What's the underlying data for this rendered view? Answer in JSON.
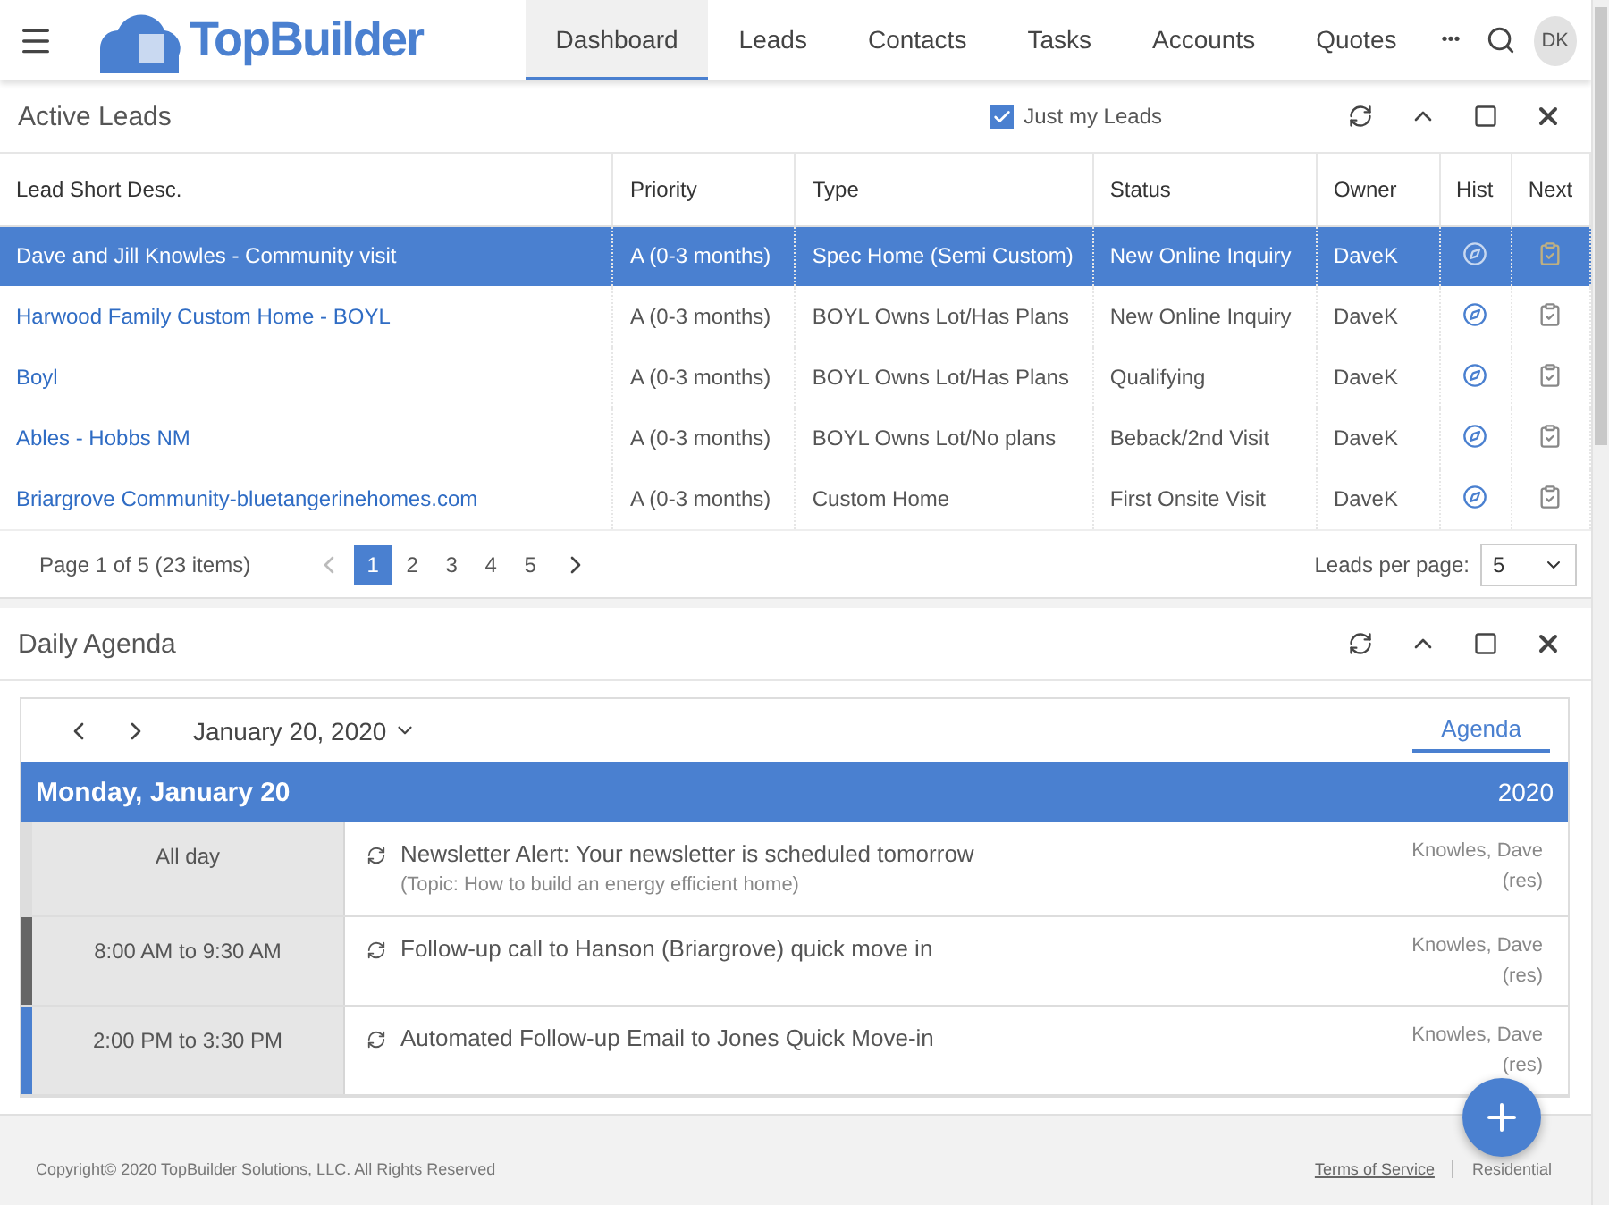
{
  "header": {
    "logo": "TopBuilder",
    "tabs": [
      {
        "label": "Dashboard",
        "selected": true
      },
      {
        "label": "Leads",
        "selected": false
      },
      {
        "label": "Contacts",
        "selected": false
      },
      {
        "label": "Tasks",
        "selected": false
      },
      {
        "label": "Accounts",
        "selected": false
      },
      {
        "label": "Quotes",
        "selected": false
      }
    ],
    "more": "•••",
    "avatar": "DK"
  },
  "active_leads": {
    "title": "Active Leads",
    "just_mine": {
      "label": "Just my Leads",
      "checked": true
    },
    "columns": [
      "Lead Short Desc.",
      "Priority",
      "Type",
      "Status",
      "Owner",
      "Hist",
      "Next"
    ],
    "rows": [
      {
        "lead": "Dave and Jill Knowles - Community visit",
        "priority": "A (0-3 months)",
        "type": "Spec Home (Semi Custom)",
        "status": "New Online Inquiry",
        "owner": "DaveK",
        "selected": true
      },
      {
        "lead": "Harwood Family Custom Home - BOYL",
        "priority": "A (0-3 months)",
        "type": "BOYL Owns Lot/Has Plans",
        "status": "New Online Inquiry",
        "owner": "DaveK",
        "selected": false
      },
      {
        "lead": "Boyl",
        "priority": "A (0-3 months)",
        "type": "BOYL Owns Lot/Has Plans",
        "status": "Qualifying",
        "owner": "DaveK",
        "selected": false
      },
      {
        "lead": "Ables - Hobbs NM",
        "priority": "A (0-3 months)",
        "type": "BOYL Owns Lot/No plans",
        "status": "Beback/2nd Visit",
        "owner": "DaveK",
        "selected": false
      },
      {
        "lead": "Briargrove Community-bluetangerinehomes.com",
        "priority": "A (0-3 months)",
        "type": "Custom Home",
        "status": "First Onsite Visit",
        "owner": "DaveK",
        "selected": false
      }
    ],
    "pager": {
      "summary": "Page 1 of 5 (23 items)",
      "pages": [
        {
          "label": "1",
          "selected": true
        },
        {
          "label": "2",
          "selected": false
        },
        {
          "label": "3",
          "selected": false
        },
        {
          "label": "4",
          "selected": false
        },
        {
          "label": "5",
          "selected": false
        }
      ],
      "per_page_label": "Leads per page:",
      "per_page": "5"
    }
  },
  "daily_agenda": {
    "title": "Daily Agenda",
    "date": "January 20, 2020",
    "view_tab": {
      "label": "Agenda",
      "selected": true
    },
    "day": "Monday, January 20",
    "year": "2020",
    "events": [
      {
        "time": "All day",
        "title": "Newsletter Alert: Your newsletter is scheduled tomorrow",
        "note": "(Topic: How to build an energy efficient home)",
        "owner": "Knowles, Dave",
        "owner_role": "(res)",
        "color": "#dddddd"
      },
      {
        "time": "8:00 AM to 9:30 AM",
        "title": "Follow-up call to Hanson (Briargrove) quick move in",
        "owner": "Knowles, Dave",
        "owner_role": "(res)",
        "color": "#666666"
      },
      {
        "time": "2:00 PM to 3:30 PM",
        "title": "Automated Follow-up Email to Jones Quick Move-in",
        "owner": "Knowles, Dave",
        "owner_role": "(res)",
        "color": "#4a80d0"
      }
    ]
  },
  "footer": {
    "copyright": "Copyright© 2020 TopBuilder Solutions, LLC. All Rights Reserved",
    "links": [
      "Terms of Service"
    ],
    "edition": "Residential"
  }
}
